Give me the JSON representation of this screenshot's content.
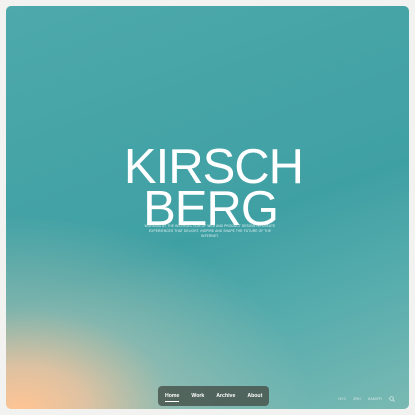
{
  "brand": {
    "line1": "KIRSCH",
    "line2": "BERG"
  },
  "tagline": "Working at the intersection of web and product design to create experiences that delight, inspire and shape the future of the internet.",
  "footer_left": {
    "item1": "",
    "item2": ""
  },
  "nav": {
    "items": [
      {
        "label": "Home",
        "active": true
      },
      {
        "label": "Work"
      },
      {
        "label": "Archive"
      },
      {
        "label": "About"
      }
    ]
  },
  "footer_right": {
    "loc1": "NYC",
    "loc2": "ZRH",
    "loc3": "HAM/FR",
    "search_icon": "search-icon"
  },
  "colors": {
    "bg_top": "#46a4a7",
    "bg_warm": "#ffc494",
    "nav_bg": "#46524a",
    "text": "#ffffff"
  }
}
